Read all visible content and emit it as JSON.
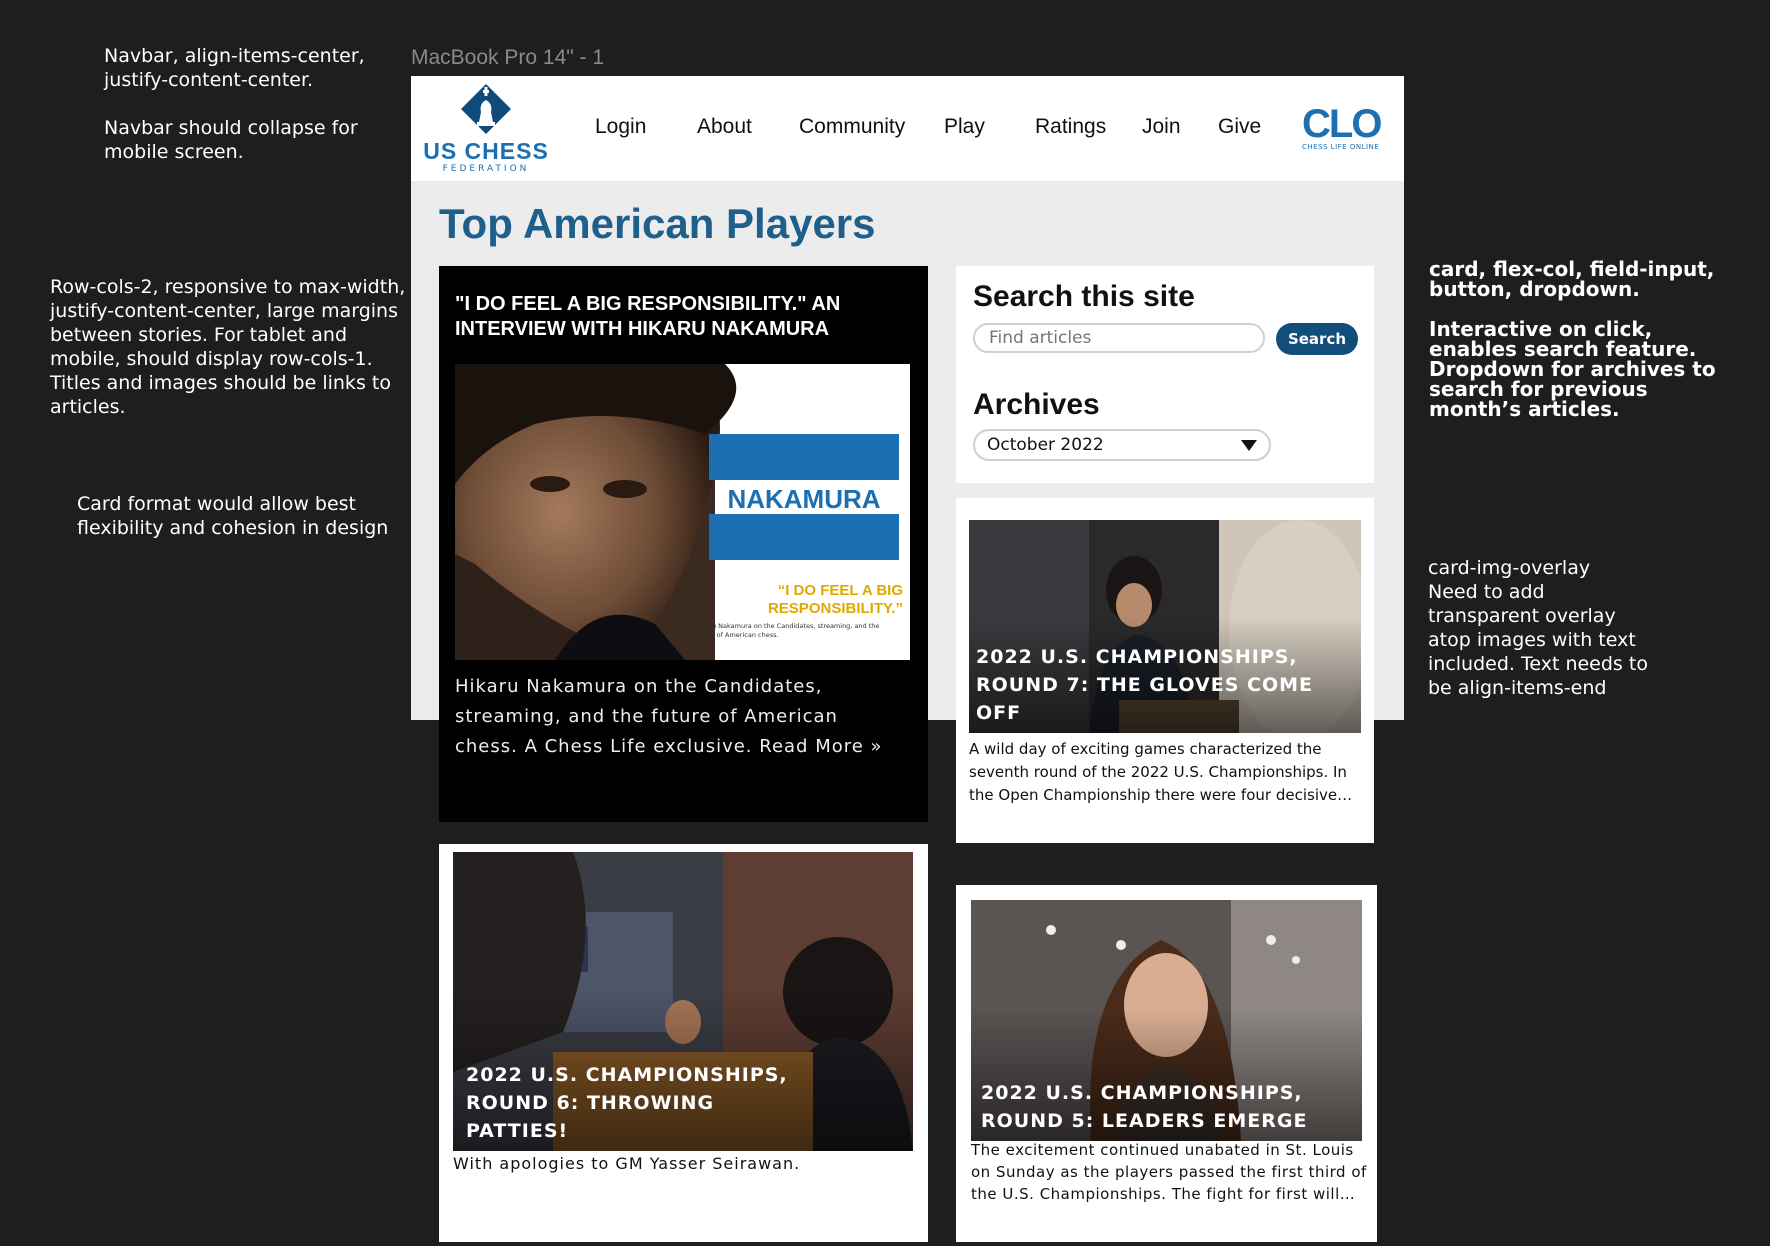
{
  "frame_label": "MacBook Pro 14\" - 1",
  "annotations": {
    "navbar_note": "Navbar, align-items-center,\njustify-content-center.\n\nNavbar should collapse for\nmobile screen.",
    "rows_note": "Row-cols-2, responsive to max-width,\njustify-content-center, large margins\nbetween stories. For tablet and\nmobile, should display row-cols-1.\nTitles and images should be links to\narticles.",
    "card_note": "Card format would allow best\nflexibility and cohesion in design",
    "search_note": "card, flex-col, field-input,\nbutton, dropdown.\n\nInteractive on click,\nenables search feature.\nDropdown for archives to\nsearch for previous\nmonth’s articles.",
    "overlay_note": "card-img-overlay\nNeed to add\ntransparent overlay\natop images with text\nincluded. Text needs to\nbe align-items-end"
  },
  "navbar": {
    "logo_text": "US CHESS",
    "logo_sub": "FEDERATION",
    "items": [
      "Login",
      "About",
      "Community",
      "Play",
      "Ratings",
      "Join",
      "Give"
    ],
    "clo_text": "CLO",
    "clo_sub": "CHESS LIFE ONLINE"
  },
  "page_title": "Top American Players",
  "feature": {
    "title": "\"I DO FEEL A BIG RESPONSIBILITY.\" AN INTERVIEW WITH HIKARU NAKAMURA",
    "img_name": "NAKAMURA",
    "img_quote": "“I DO FEEL A BIG RESPONSIBILITY.”",
    "img_caption": "Hikaru Nakamura on the Candidates, streaming, and the future of American chess.",
    "description": "Hikaru Nakamura on the Candidates, streaming, and the future of American chess. A Chess Life exclusive. Read More »"
  },
  "search": {
    "title": "Search this site",
    "placeholder": "Find articles",
    "button": "Search",
    "archives_title": "Archives",
    "archives_selected": "October 2022"
  },
  "stories": [
    {
      "title": "2022 U.S. CHAMPIONSHIPS, ROUND 7: THE GLOVES COME OFF",
      "description": "A wild day of exciting games characterized the seventh round of the 2022 U.S. Championships. In the Open Championship there were four decisive…"
    },
    {
      "title": "2022 U.S. CHAMPIONSHIPS, ROUND 6: THROWING PATTIES!",
      "description": "With apologies to GM Yasser Seirawan."
    },
    {
      "title": "2022 U.S. CHAMPIONSHIPS, ROUND 5: LEADERS EMERGE",
      "description": "The excitement continued unabated in St. Louis on Sunday as the players passed the first third of the U.S. Championships. The fight for first will…"
    }
  ]
}
